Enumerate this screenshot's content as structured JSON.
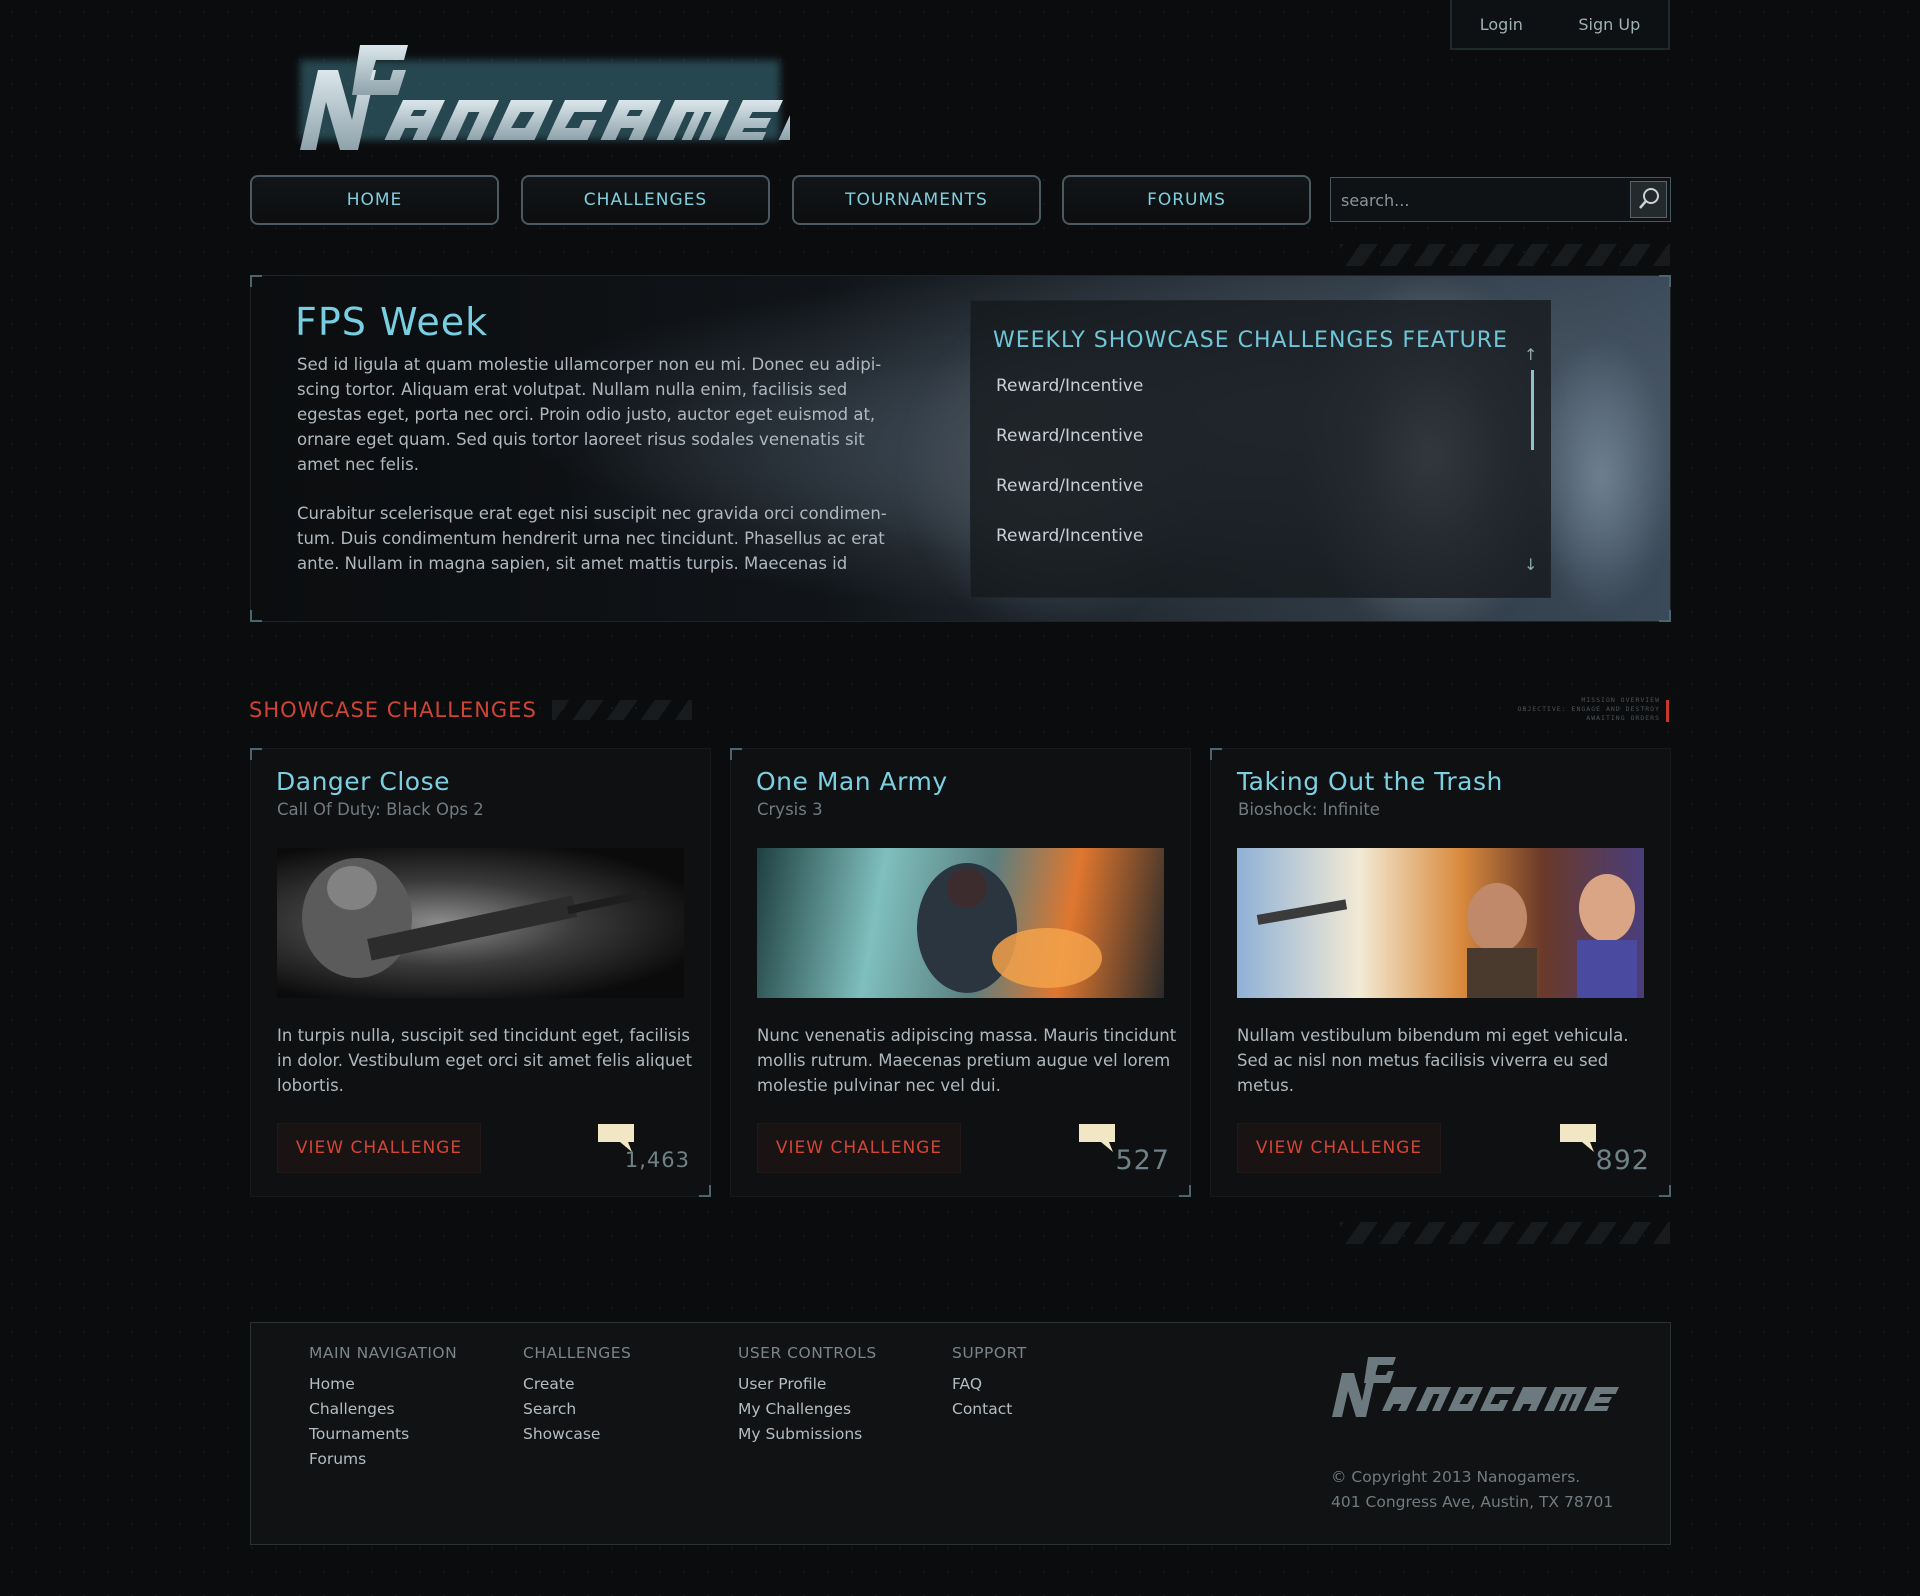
{
  "colors": {
    "accent_cyan": "#7dd0e2",
    "accent_red": "#cf4436",
    "background": "#0b0c0e"
  },
  "auth": {
    "login": "Login",
    "signup": "Sign Up"
  },
  "logo": {
    "text": "NANOGAMERS",
    "monogram": "NG"
  },
  "nav": {
    "items": [
      "HOME",
      "CHALLENGES",
      "TOURNAMENTS",
      "FORUMS"
    ]
  },
  "search": {
    "placeholder": "search...",
    "icon": "search-icon"
  },
  "hero": {
    "title": "FPS Week",
    "paragraph1": "Sed id ligula at quam molestie ullamcorper non eu mi. Donec eu adipi-scing tortor. Aliquam erat volutpat. Nullam nulla enim, facilisis sed egestas eget, porta nec orci. Proin odio justo, auctor eget euismod at, ornare eget quam. Sed quis tortor laoreet risus sodales venenatis sit amet nec felis.",
    "paragraph2": "Curabitur scelerisque erat eget nisi suscipit nec gravida orci condimen-tum. Duis condimentum hendrerit urna nec tincidunt. Phasellus ac erat ante. Nullam in magna sapien, sit amet mattis turpis. Maecenas id",
    "feature_title": "WEEKLY SHOWCASE CHALLENGES FEATURE",
    "rewards": [
      "Reward/Incentive",
      "Reward/Incentive",
      "Reward/Incentive",
      "Reward/Incentive"
    ]
  },
  "showcase": {
    "title": "SHOWCASE CHALLENGES",
    "mission_lines": [
      "MISSION OVERVIEW",
      "OBJECTIVE: ENGAGE AND DESTROY",
      "AWAITING ORDERS"
    ],
    "cards": [
      {
        "title": "Danger Close",
        "game": "Call Of Duty: Black Ops 2",
        "description": "In turpis nulla, suscipit sed tincidunt eget, facilisis in dolor. Vestibulum eget orci sit amet felis aliquet lobortis.",
        "button": "VIEW CHALLENGE",
        "count": "1,463"
      },
      {
        "title": "One Man Army",
        "game": "Crysis 3",
        "description": "Nunc venenatis adipiscing massa. Mauris tincidunt mollis rutrum. Maecenas pretium augue vel lorem molestie pulvinar nec vel dui.",
        "button": "VIEW CHALLENGE",
        "count": "527"
      },
      {
        "title": "Taking Out the Trash",
        "game": "Bioshock: Infinite",
        "description": "Nullam vestibulum bibendum mi eget vehicula. Sed ac nisl non metus facilisis viverra eu sed metus.",
        "button": "VIEW CHALLENGE",
        "count": "892"
      }
    ]
  },
  "footer": {
    "columns": [
      {
        "heading": "MAIN NAVIGATION",
        "links": [
          "Home",
          "Challenges",
          "Tournaments",
          "Forums"
        ]
      },
      {
        "heading": "CHALLENGES",
        "links": [
          "Create",
          "Search",
          "Showcase"
        ]
      },
      {
        "heading": "USER CONTROLS",
        "links": [
          "User Profile",
          "My Challenges",
          "My Submissions"
        ]
      },
      {
        "heading": "SUPPORT",
        "links": [
          "FAQ",
          "Contact"
        ]
      }
    ],
    "copyright": "© Copyright 2013 Nanogamers.",
    "address": "401 Congress Ave, Austin, TX 78701"
  }
}
